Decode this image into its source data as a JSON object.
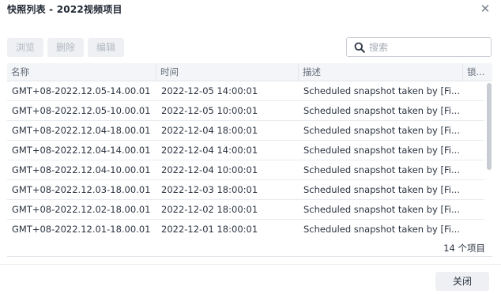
{
  "dialog": {
    "title": "快照列表 - 2022视频项目",
    "close_icon": "✕"
  },
  "toolbar": {
    "browse_label": "浏览",
    "delete_label": "删除",
    "edit_label": "编辑"
  },
  "search": {
    "placeholder": "搜索",
    "value": ""
  },
  "table": {
    "columns": [
      "名称",
      "时间",
      "描述",
      "锁..."
    ],
    "rows": [
      {
        "name": "GMT+08-2022.12.05-14.00.01",
        "time": "2022-12-05 14:00:01",
        "desc": "Scheduled snapshot taken by [Fi...",
        "lock": ""
      },
      {
        "name": "GMT+08-2022.12.05-10.00.01",
        "time": "2022-12-05 10:00:01",
        "desc": "Scheduled snapshot taken by [Fi...",
        "lock": ""
      },
      {
        "name": "GMT+08-2022.12.04-18.00.01",
        "time": "2022-12-04 18:00:01",
        "desc": "Scheduled snapshot taken by [Fi...",
        "lock": ""
      },
      {
        "name": "GMT+08-2022.12.04-14.00.01",
        "time": "2022-12-04 14:00:01",
        "desc": "Scheduled snapshot taken by [Fi...",
        "lock": ""
      },
      {
        "name": "GMT+08-2022.12.04-10.00.01",
        "time": "2022-12-04 10:00:01",
        "desc": "Scheduled snapshot taken by [Fi...",
        "lock": ""
      },
      {
        "name": "GMT+08-2022.12.03-18.00.01",
        "time": "2022-12-03 18:00:01",
        "desc": "Scheduled snapshot taken by [Fi...",
        "lock": ""
      },
      {
        "name": "GMT+08-2022.12.02-18.00.01",
        "time": "2022-12-02 18:00:01",
        "desc": "Scheduled snapshot taken by [Fi...",
        "lock": ""
      },
      {
        "name": "GMT+08-2022.12.01-18.00.01",
        "time": "2022-12-01 18:00:01",
        "desc": "Scheduled snapshot taken by [Fi...",
        "lock": ""
      }
    ],
    "item_count": "14 个项目"
  },
  "footer": {
    "close_label": "关闭"
  },
  "colors": {
    "accent": "#1f2733",
    "disabled_button_text": "#b3b9c2",
    "button_bg": "#eef0f3",
    "header_bg": "#f3f5f8"
  }
}
